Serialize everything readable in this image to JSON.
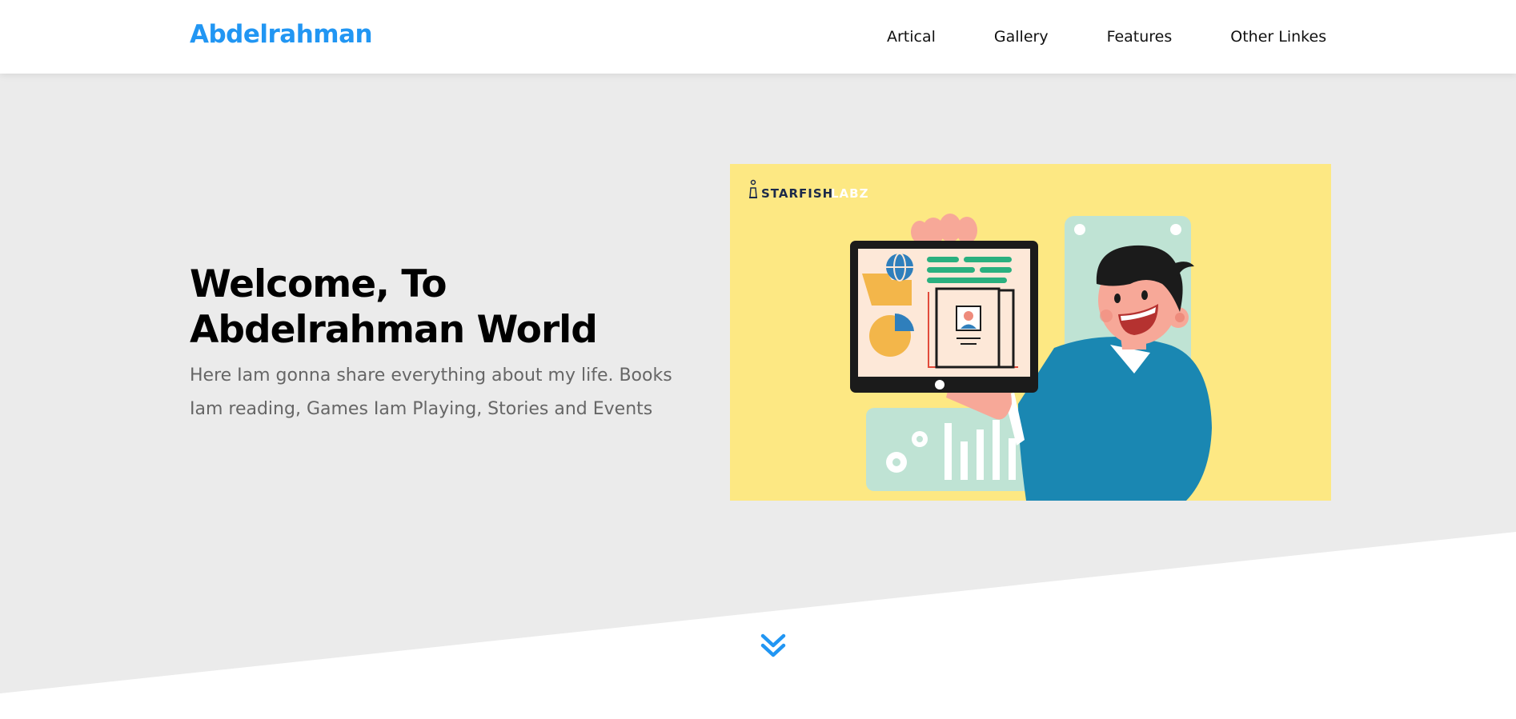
{
  "header": {
    "logo": "Abdelrahman",
    "nav": [
      "Artical",
      "Gallery",
      "Features",
      "Other Linkes"
    ]
  },
  "intro": {
    "title": "Welcome, To Abdelrahman World",
    "text": "Here Iam gonna share everything about my life. Books Iam reading, Games Iam Playing, Stories and Events"
  },
  "hero_image": {
    "brand": "STARFISH",
    "brand_suffix": "LABZ"
  },
  "colors": {
    "accent": "#2196f3",
    "landing_bg": "#ebebeb",
    "hero_bg": "#fde883"
  },
  "icons": {
    "go_down": "chevrons-down-icon"
  }
}
